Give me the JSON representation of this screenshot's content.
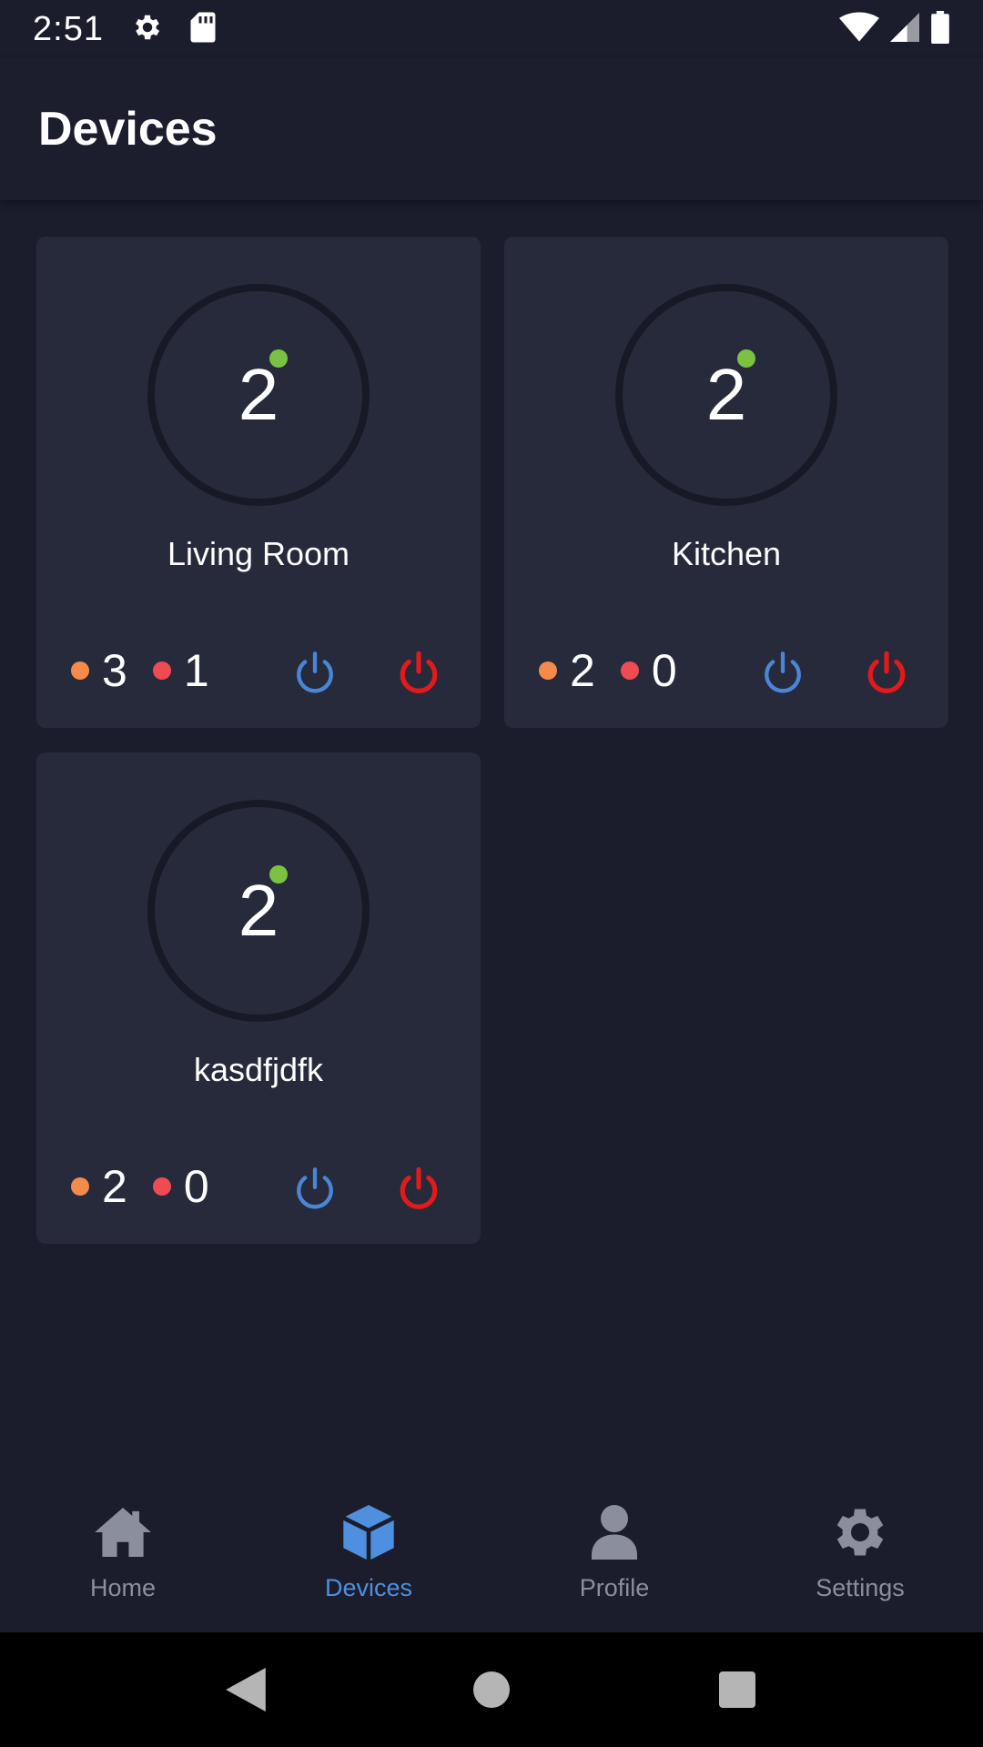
{
  "status_bar": {
    "time": "2:51",
    "icons": [
      "gear-icon",
      "sd-card-icon",
      "wifi-icon",
      "signal-icon",
      "battery-icon"
    ]
  },
  "header": {
    "title": "Devices"
  },
  "colors": {
    "online": "#7cc242",
    "warning": "#f58a4b",
    "error": "#ef4b52",
    "power_on": "#4a86d6",
    "power_off": "#e01b1b",
    "accent": "#4f8fe0"
  },
  "devices": [
    {
      "count": "2",
      "name": "Living Room",
      "warnings": "3",
      "errors": "1"
    },
    {
      "count": "2",
      "name": "Kitchen",
      "warnings": "2",
      "errors": "0"
    },
    {
      "count": "2",
      "name": "kasdfjdfk",
      "warnings": "2",
      "errors": "0"
    }
  ],
  "bottom_nav": {
    "items": [
      {
        "label": "Home",
        "icon": "home-icon",
        "active": false
      },
      {
        "label": "Devices",
        "icon": "cube-icon",
        "active": true
      },
      {
        "label": "Profile",
        "icon": "person-icon",
        "active": false
      },
      {
        "label": "Settings",
        "icon": "gear-icon",
        "active": false
      }
    ]
  }
}
